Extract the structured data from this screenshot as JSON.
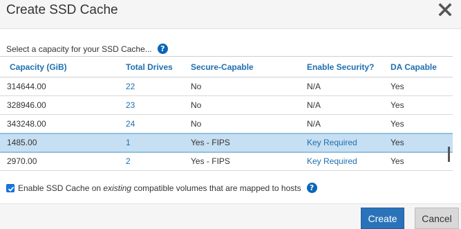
{
  "dialog": {
    "title": "Create SSD Cache"
  },
  "prompt": "Select a capacity for your SSD Cache...",
  "help_glyph": "?",
  "table": {
    "headers": [
      "Capacity (GiB)",
      "Total Drives",
      "Secure-Capable",
      "Enable Security?",
      "DA Capable"
    ],
    "rows": [
      {
        "capacity": "314644.00",
        "drives": "22",
        "secure": "No",
        "enable": "N/A",
        "da": "Yes"
      },
      {
        "capacity": "328946.00",
        "drives": "23",
        "secure": "No",
        "enable": "N/A",
        "da": "Yes"
      },
      {
        "capacity": "343248.00",
        "drives": "24",
        "secure": "No",
        "enable": "N/A",
        "da": "Yes"
      },
      {
        "capacity": "1485.00",
        "drives": "1",
        "secure": "Yes - FIPS",
        "enable": "Key Required",
        "da": "Yes"
      },
      {
        "capacity": "2970.00",
        "drives": "2",
        "secure": "Yes - FIPS",
        "enable": "Key Required",
        "da": "Yes"
      }
    ],
    "selected_row": 3
  },
  "enable_option": {
    "checked": true,
    "text_before": "Enable SSD Cache on ",
    "text_em": "existing",
    "text_after": " compatible volumes that are mapped to hosts"
  },
  "buttons": {
    "create": "Create",
    "cancel": "Cancel"
  },
  "colors": {
    "accent": "#1e6fb0",
    "selected_row": "#c6dff2",
    "primary_button": "#2a73ba"
  }
}
